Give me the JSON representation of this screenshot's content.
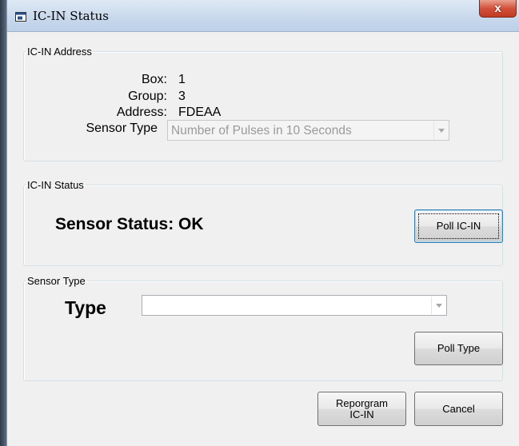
{
  "window": {
    "title": "IC-IN Status",
    "close_glyph": "x",
    "icon": "window-icon"
  },
  "address_group": {
    "legend": "IC-IN Address",
    "box_label": "Box:",
    "box_value": "1",
    "group_label": "Group:",
    "group_value": "3",
    "address_label": "Address:",
    "address_value": "FDEAA",
    "sensor_type_label": "Sensor Type",
    "sensor_type_value": "Number of Pulses in 10 Seconds"
  },
  "status_group": {
    "legend": "IC-IN Status",
    "sensor_status": "Sensor Status: OK",
    "poll_button": "Poll IC-IN"
  },
  "type_group": {
    "legend": "Sensor Type",
    "type_label": "Type",
    "type_value": "",
    "poll_button": "Poll Type"
  },
  "footer": {
    "reprogram_line1": "Reporgram",
    "reprogram_line2": "IC-IN",
    "cancel_button": "Cancel"
  },
  "colors": {
    "close_button": "#c13a22",
    "titlebar": "#c9d9ec",
    "dialog_bg": "#f0f0f0"
  }
}
